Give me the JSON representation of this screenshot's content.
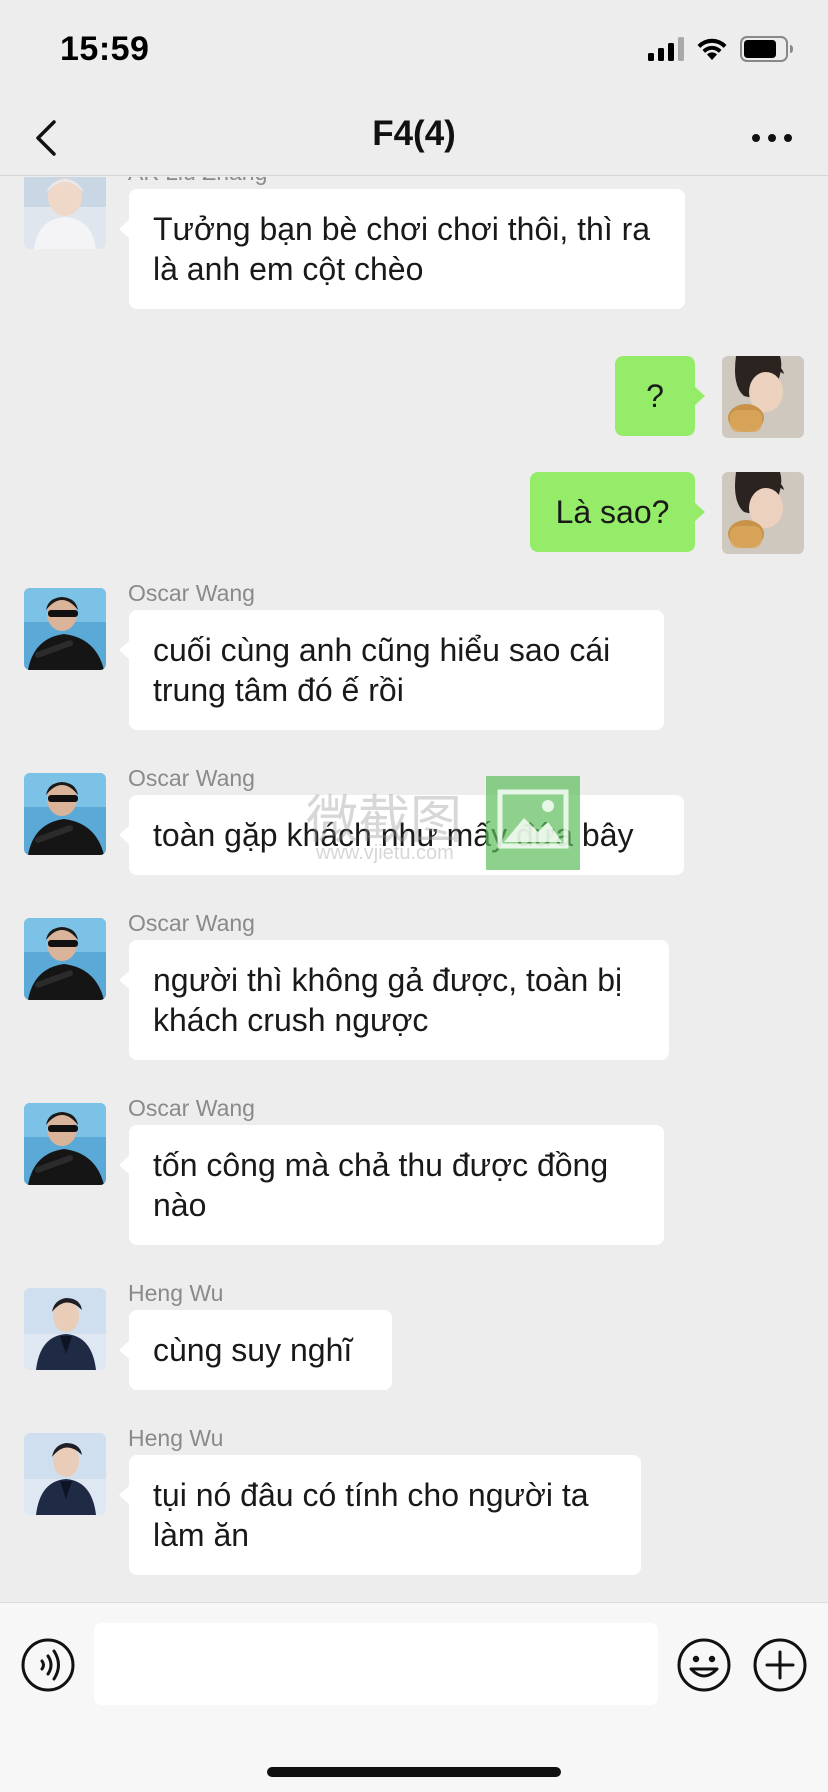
{
  "status_bar": {
    "time": "15:59",
    "battery_level": 0.8
  },
  "nav": {
    "title": "F4(4)"
  },
  "messages": [
    {
      "from": "in",
      "sender": "AK Liu Zhang",
      "text": "Tưởng bạn bè chơi chơi thôi, thì ra là anh em cột chèo",
      "avatar": "avatar-ak"
    },
    {
      "from": "out",
      "sender": "",
      "text": "?",
      "avatar": "avatar-me"
    },
    {
      "from": "out",
      "sender": "",
      "text": "Là sao?",
      "avatar": "avatar-me"
    },
    {
      "from": "in",
      "sender": "Oscar Wang",
      "text": "cuối cùng anh cũng hiểu sao cái trung tâm đó ế rồi",
      "avatar": "avatar-oscar"
    },
    {
      "from": "in",
      "sender": "Oscar Wang",
      "text": "toàn gặp khách như mấy đứa bây",
      "avatar": "avatar-oscar"
    },
    {
      "from": "in",
      "sender": "Oscar Wang",
      "text": "người thì không gả được, toàn bị khách crush ngược",
      "avatar": "avatar-oscar"
    },
    {
      "from": "in",
      "sender": "Oscar Wang",
      "text": "tốn công mà chả thu được đồng nào",
      "avatar": "avatar-oscar"
    },
    {
      "from": "in",
      "sender": "Heng Wu",
      "text": "cùng suy nghĩ",
      "avatar": "avatar-heng"
    },
    {
      "from": "in",
      "sender": "Heng Wu",
      "text": "tụi nó đâu có tính cho người ta làm ăn",
      "avatar": "avatar-heng"
    }
  ],
  "watermark": {
    "text": "微截图",
    "url": "www.vjietu.com"
  },
  "input": {
    "value": "",
    "placeholder": ""
  },
  "colors": {
    "background": "#ededed",
    "incoming_bubble": "#ffffff",
    "outgoing_bubble": "#95ec69"
  },
  "icons": {
    "back": "chevron-left-icon",
    "more": "more-icon",
    "voice": "voice-icon",
    "emoji": "emoji-icon",
    "plus": "plus-icon"
  }
}
